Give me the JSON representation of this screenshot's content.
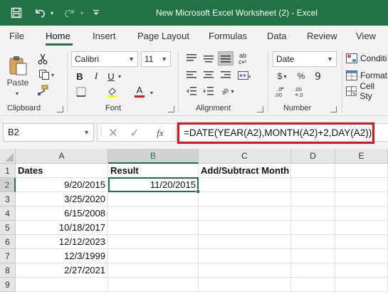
{
  "window": {
    "title": "New Microsoft Excel Worksheet (2)  -  Excel"
  },
  "menu": {
    "tabs": [
      {
        "label": "File"
      },
      {
        "label": "Home",
        "active": true
      },
      {
        "label": "Insert"
      },
      {
        "label": "Page Layout"
      },
      {
        "label": "Formulas"
      },
      {
        "label": "Data"
      },
      {
        "label": "Review"
      },
      {
        "label": "View"
      }
    ]
  },
  "ribbon": {
    "clipboard": {
      "paste_label": "Paste",
      "group_label": "Clipboard"
    },
    "font": {
      "font_name": "Calibri",
      "font_size": "11",
      "group_label": "Font",
      "bold": "B",
      "italic": "I",
      "underline": "U",
      "grow": "A",
      "shrink": "A"
    },
    "alignment": {
      "group_label": "Alignment"
    },
    "number": {
      "format": "Date",
      "currency": "$",
      "percent": "%",
      "group_label": "Number"
    },
    "styles": {
      "conditional": "Conditi",
      "format_table": "Format",
      "cell_styles": "Cell Sty"
    }
  },
  "formula_bar": {
    "name_box": "B2",
    "fx": "fx",
    "formula": "=DATE(YEAR(A2),MONTH(A2)+2,DAY(A2))"
  },
  "grid": {
    "columns": [
      "A",
      "B",
      "C",
      "D",
      "E"
    ],
    "rows": [
      "1",
      "2",
      "3",
      "4",
      "5",
      "6",
      "7",
      "8",
      "9"
    ],
    "headers": {
      "a1": "Dates",
      "b1": "Result",
      "c1": "Add/Subtract Month"
    },
    "dates": [
      "9/20/2015",
      "3/25/2020",
      "6/15/2008",
      "10/18/2017",
      "12/12/2023",
      "12/3/1999",
      "2/27/2021"
    ],
    "result": "11/20/2015"
  },
  "colors": {
    "brand": "#217346",
    "highlight": "#e0141e"
  }
}
